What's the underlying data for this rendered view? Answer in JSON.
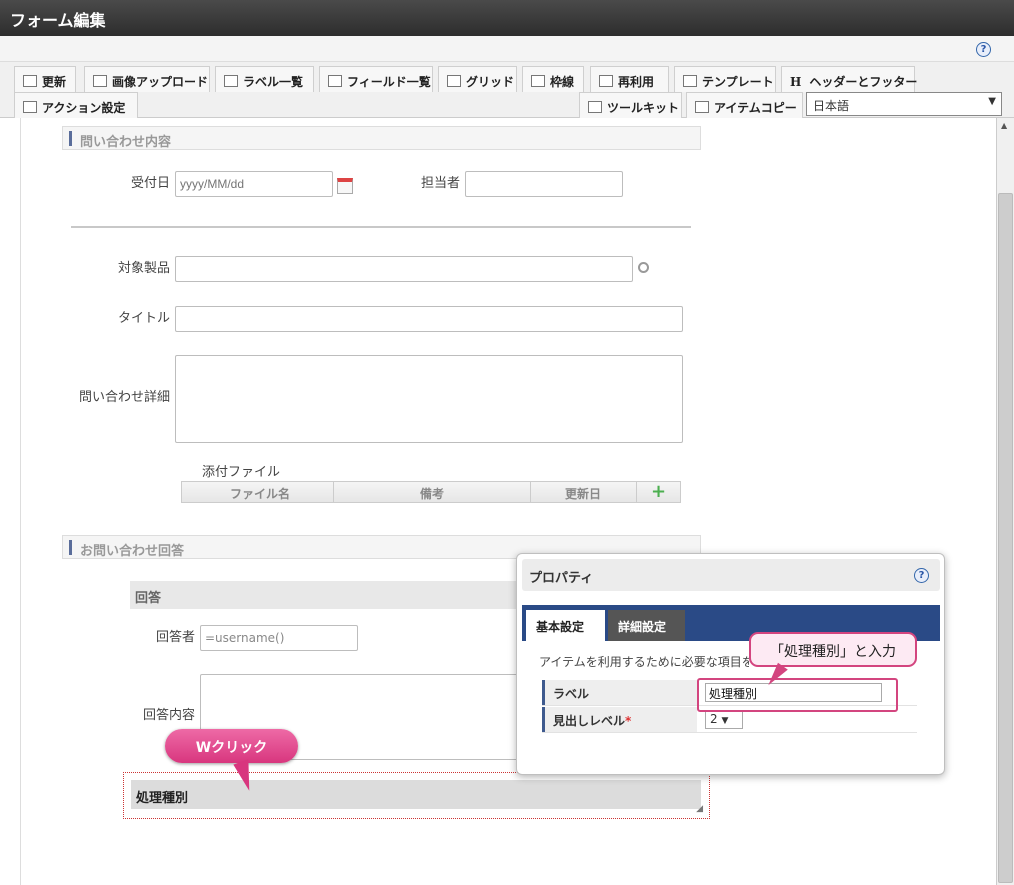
{
  "window": {
    "title": "フォーム編集",
    "help_icon": "?"
  },
  "toolbar": {
    "row1": [
      "更新",
      "画像アップロード",
      "ラベル一覧",
      "フィールド一覧",
      "グリッド",
      "枠線",
      "再利用",
      "テンプレート",
      "ヘッダーとフッター"
    ],
    "action": "アクション設定",
    "toolkit": "ツールキット",
    "item_copy": "アイテムコピー",
    "language": "日本語",
    "header_icon_letter": "H"
  },
  "form": {
    "section1": "問い合わせ内容",
    "reception_date_label": "受付日",
    "reception_date_placeholder": "yyyy/MM/dd",
    "assignee_label": "担当者",
    "product_label": "対象製品",
    "title_label": "タイトル",
    "detail_label": "問い合わせ詳細",
    "attachment_label": "添付ファイル",
    "table_headers": [
      "ファイル名",
      "備考",
      "更新日"
    ],
    "section2": "お問い合わせ回答",
    "answer_heading": "回答",
    "responder_label": "回答者",
    "responder_value": "=username()",
    "answer_content_label": "回答内容",
    "selected_heading": "処理種別"
  },
  "properties": {
    "title": "プロパティ",
    "help_icon": "?",
    "tabs": [
      "基本設定",
      "詳細設定"
    ],
    "description": "アイテムを利用するために必要な項目を設",
    "label_label": "ラベル",
    "label_value": "処理種別",
    "heading_level_label": "見出しレベル",
    "required_mark": "*",
    "heading_level_value": "2"
  },
  "annotations": {
    "double_click": "Wクリック",
    "input_note": "「処理種別」と入力"
  }
}
